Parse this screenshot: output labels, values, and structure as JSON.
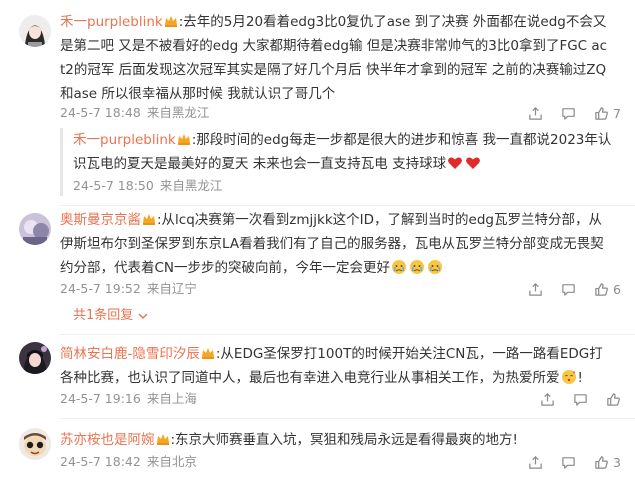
{
  "comments": [
    {
      "username": "禾一purpleblink",
      "text": ":去年的5月20看着edg3比0复仇了ase 到了决赛 外面都在说edg不会又是第二吧 又是不被看好的edg 大家都期待着edg输 但是决赛非常帅气的3比0拿到了FGC act2的冠军 后面发现这次冠军其实是隔了好几个月后 快半年才拿到的冠军 之前的决赛输过ZQ和ase 所以很幸福从那时候 我就认识了哥几个",
      "time": "24-5-7 18:48",
      "location": "来自黑龙江",
      "like_count": "7",
      "reply": {
        "username": "禾一purpleblink",
        "text": ":那段时间的edg每走一步都是很大的进步和惊喜 我一直都说2023年认识瓦电的夏天是最美好的夏天 未来也会一直支持瓦电 支持球球",
        "time": "24-5-7 18:50",
        "location": "来自黑龙江"
      }
    },
    {
      "username": "奥斯曼京京酱",
      "text": ":从lcq决赛第一次看到zmjjkk这个ID，了解到当时的edg瓦罗兰特分部，从伊斯坦布尔到圣保罗到东京LA看着我们有了自己的服务器，瓦电从瓦罗兰特分部变成无畏契约分部，代表着CN一步步的突破向前，今年一定会更好",
      "time": "24-5-7 19:52",
      "location": "来自辽宁",
      "like_count": "6",
      "more_replies": "共1条回复"
    },
    {
      "username": "简林安白鹿-隐雪印汐辰",
      "text": ":从EDG圣保罗打100T的时候开始关注CN瓦，一路一路看EDG打各种比赛，也认识了同道中人，最后也有幸进入电竞行业从事相关工作，为热爱所爱",
      "text_end": "!",
      "time": "24-5-7 19:16",
      "location": "来自上海"
    },
    {
      "username": "苏亦桉也是阿婉",
      "text": ":东京大师赛垂直入坑，冥狙和残局永远是看得最爽的地方!",
      "time": "24-5-7 18:42",
      "location": "来自北京",
      "like_count": "3"
    }
  ],
  "icons": {
    "share": "share-icon",
    "comment": "comment-icon",
    "like": "like-icon",
    "badge": "fan-crown-badge-icon"
  },
  "colors": {
    "username": "#eb7350",
    "meta": "#939393",
    "text": "#333333"
  }
}
